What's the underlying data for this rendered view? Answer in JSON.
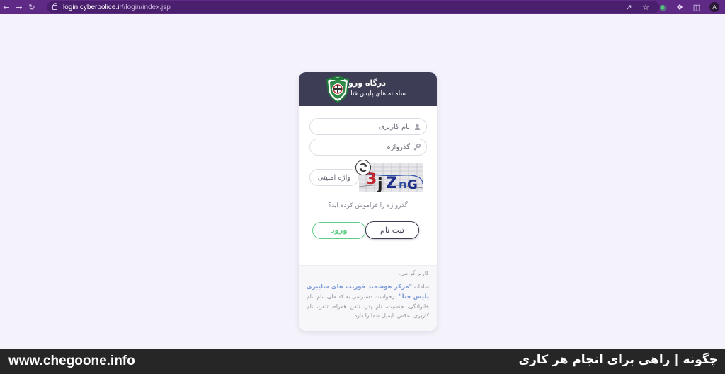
{
  "browser": {
    "url_host": "login.cyberpolice.ir",
    "url_path": "//login/index.jsp",
    "avatar_letter": "A",
    "icons": [
      "back-arrow-icon",
      "forward-arrow-icon",
      "reload-icon",
      "share-icon",
      "star-icon",
      "extension-green-icon",
      "puzzle-icon",
      "sidebar-icon"
    ]
  },
  "card": {
    "header": {
      "title": "درگاه ورود",
      "subtitle": "سامانه های پلیس فتا",
      "background": "#3e3d56"
    },
    "username": {
      "placeholder": "نام کاربری",
      "icon": "user-icon"
    },
    "password": {
      "placeholder": "گذرواژه",
      "icon": "key-icon"
    },
    "captcha": {
      "placeholder": "واژه امنیتی",
      "image_text": "3jZnG",
      "refresh_icon": "refresh-icon"
    },
    "forgot_password": "گذرواژه را فراموش کرده اید؟",
    "buttons": {
      "register": "ثبت نام",
      "login": "ورود",
      "login_color": "#5fcf85"
    },
    "notice": {
      "greeting": "کاربر گرامی،",
      "prefix": "سامانه",
      "highlight": "\"مرکز هوشمند فوریت های سایبری پلیس فتا\"",
      "body": "درخواست دسترسی به کد ملی، نام، نام خانوادگی، جنسیت، نام پدر، تلفن همراه، تلفن، نام کاربری، عکس، ایمیل شما را دارد"
    }
  },
  "banner": {
    "site": "www.chegoone.info",
    "slogan": "چگونه | راهی برای انجام هر کاری"
  }
}
